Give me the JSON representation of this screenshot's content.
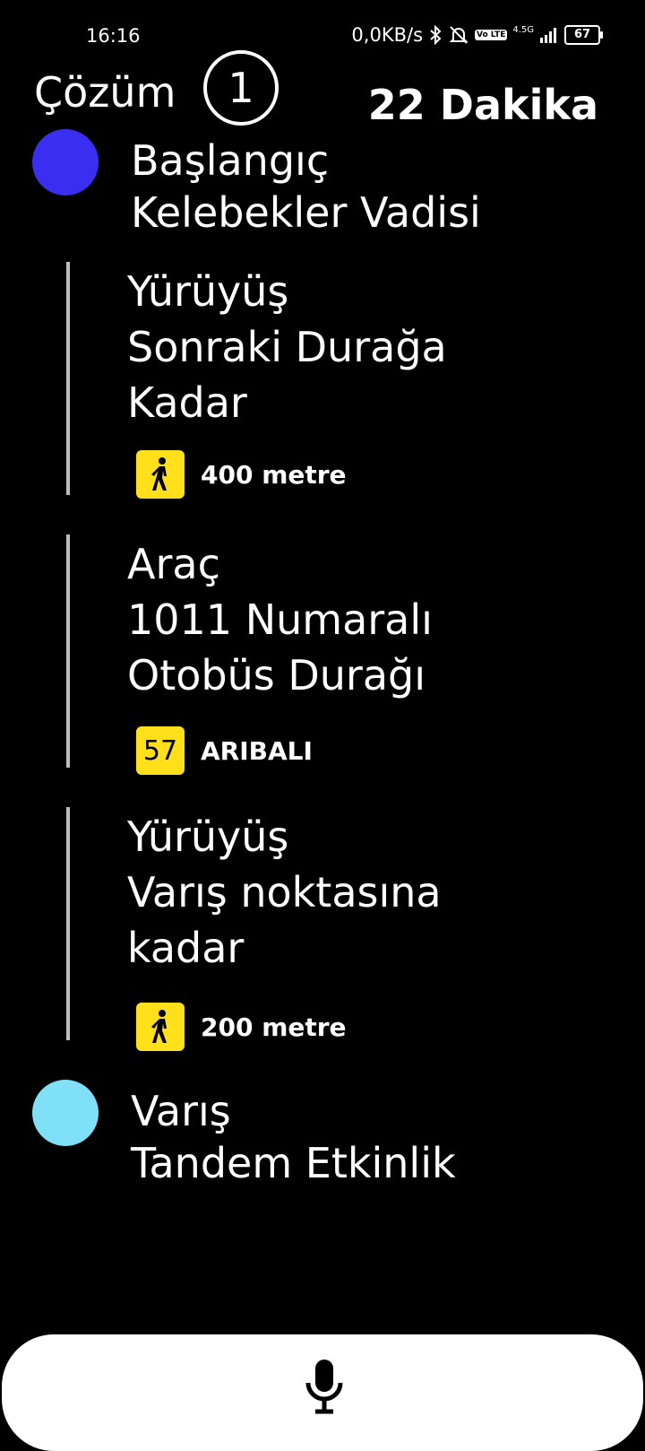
{
  "status": {
    "time": "16:16",
    "speed": "0,0KB/s",
    "network": "4.5G",
    "lte_badge": "Vo LTE",
    "battery": "67"
  },
  "header": {
    "title": "Çözüm",
    "solution_number": "1",
    "duration": "22 Dakika"
  },
  "start": {
    "label": "Başlangıç",
    "place": "Kelebekler Vadisi",
    "color": "#3a2ff0"
  },
  "steps": [
    {
      "type": "Yürüyüş",
      "line1": "Sonraki Durağa",
      "line2": "Kadar",
      "icon": "walking-person-icon",
      "meta": "400 metre"
    },
    {
      "type": "Araç",
      "line1": "1011 Numaralı",
      "line2": "Otobüs Durağı",
      "route": "57",
      "meta": "ARIBALI"
    },
    {
      "type": "Yürüyüş",
      "line1": "Varış noktasına",
      "line2": "kadar",
      "icon": "walking-person-icon",
      "meta": "200 metre"
    }
  ],
  "end": {
    "label": "Varış",
    "place": "Tandem Etkinlik",
    "color": "#7fe0f8"
  },
  "bottom": {
    "icon": "microphone-icon"
  },
  "colors": {
    "background": "#000000",
    "badge": "#ffe01a",
    "line": "#bdbdbd"
  }
}
